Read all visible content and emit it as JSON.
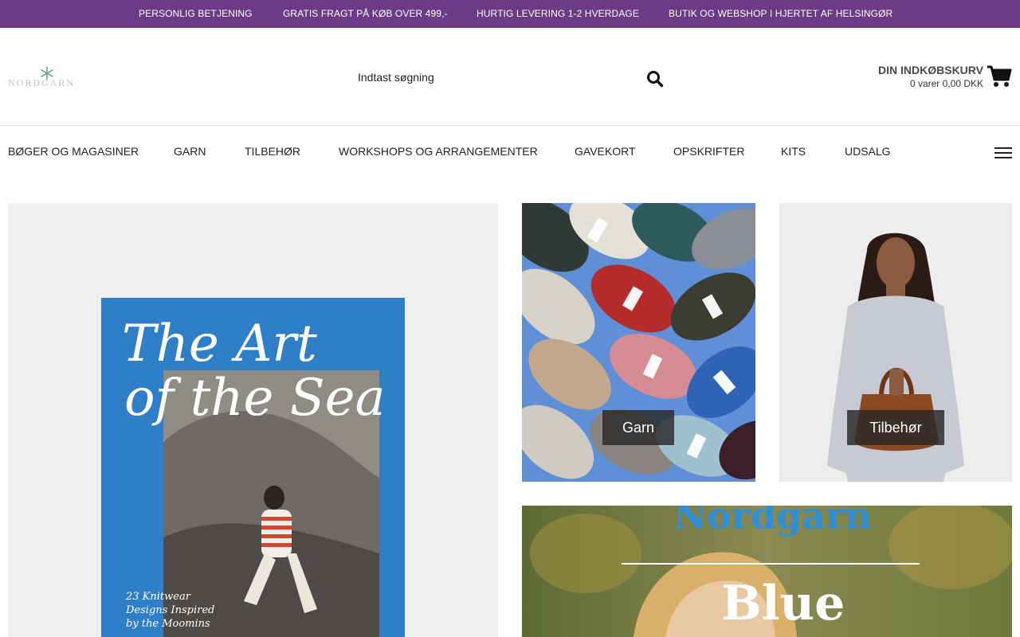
{
  "topbar": {
    "messages": [
      "PERSONLIG BETJENING",
      "GRATIS FRAGT PÅ KØB OVER 499,-",
      "HURTIG LEVERING 1-2 HVERDAGE",
      "BUTIK OG WEBSHOP I HJERTET AF HELSINGØR"
    ],
    "background": "#6b3b86"
  },
  "header": {
    "logo_text": "NORDGARN",
    "search": {
      "placeholder": "Indtast søgning",
      "icon": "search-icon"
    },
    "cart": {
      "title": "DIN INDKØBSKURV",
      "summary": "0 varer 0,00 DKK",
      "icon": "shopping-cart-icon"
    }
  },
  "nav": {
    "items": [
      "BØGER OG MAGASINER",
      "GARN",
      "TILBEHØR",
      "WORKSHOPS OG ARRANGEMENTER",
      "GAVEKORT",
      "OPSKRIFTER",
      "KITS",
      "UDSALG"
    ],
    "menu_icon": "hamburger-menu-icon"
  },
  "tiles": {
    "books": {
      "cover_title_line1": "The Art",
      "cover_title_line2": "of the Sea",
      "cover_subtitle": [
        "23 Knitwear",
        "Designs Inspired",
        "by the Moomins"
      ],
      "cover_color": "#2f7fc8"
    },
    "garn": {
      "label": "Garn"
    },
    "tilbehor": {
      "label": "Tilbehør"
    },
    "blue": {
      "brand": "Nordgarn",
      "title": "Blue"
    }
  }
}
